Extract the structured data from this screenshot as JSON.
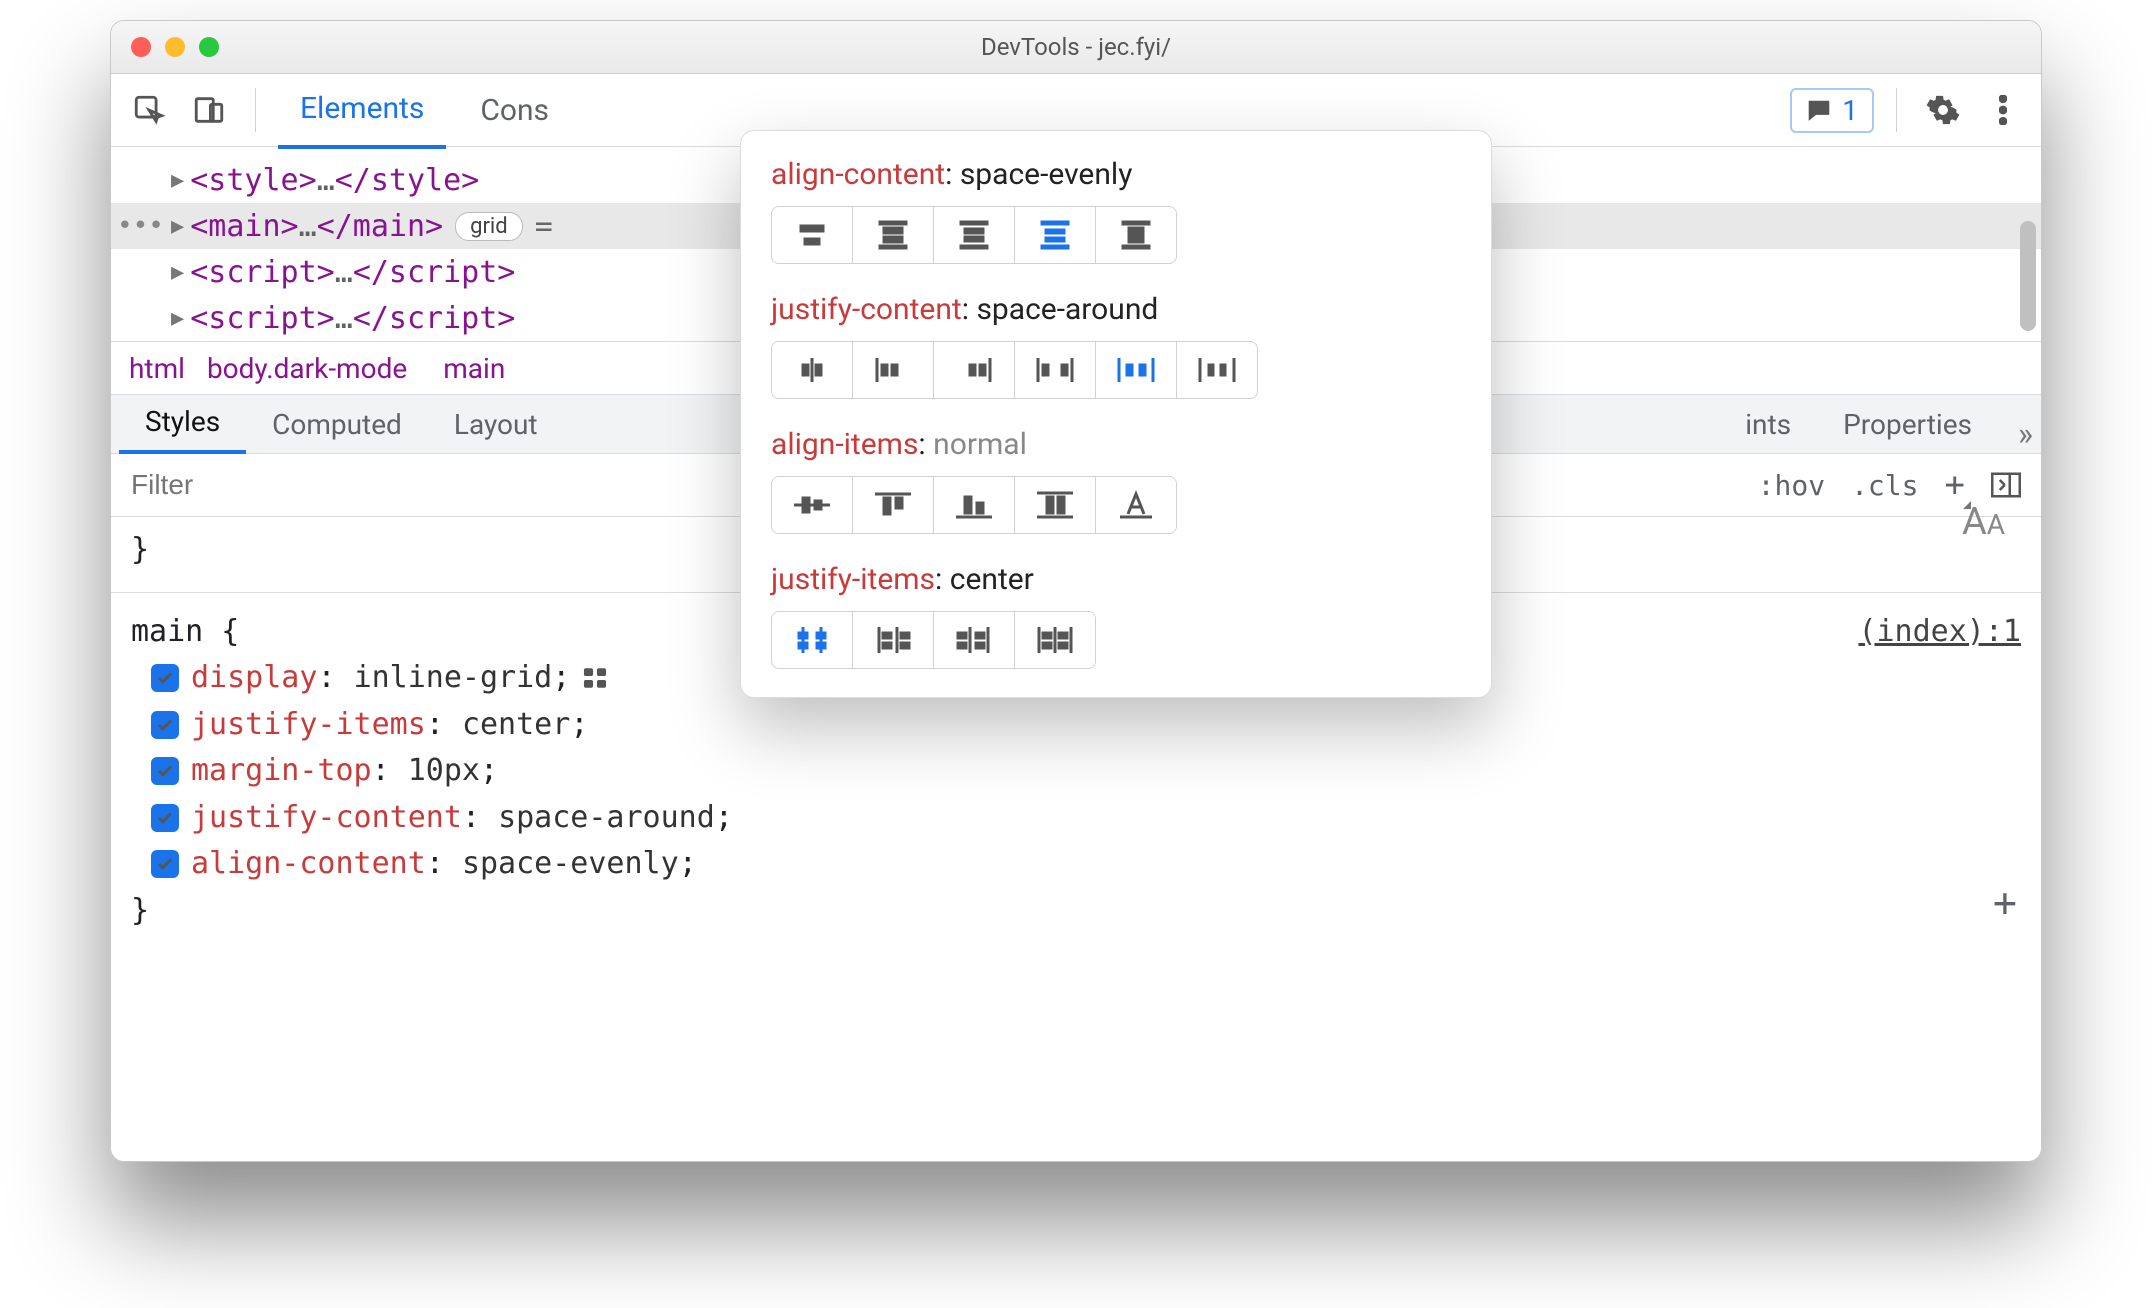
{
  "window": {
    "title": "DevTools - jec.fyi/"
  },
  "toolbar": {
    "tabs": [
      "Elements",
      "Cons"
    ],
    "active_tab": 0,
    "feedback_count": "1"
  },
  "dom": {
    "rows": [
      {
        "open": "<style>",
        "mid": "…",
        "close": "</style>",
        "selected": false
      },
      {
        "open": "<main>",
        "mid": "…",
        "close": "</main>",
        "selected": true,
        "badge": "grid",
        "eq": "="
      },
      {
        "open": "<script>",
        "mid": "…",
        "close": "</script>",
        "selected": false
      },
      {
        "open": "<script>",
        "mid": "…",
        "close": "</script>",
        "selected": false
      }
    ]
  },
  "breadcrumbs": {
    "items": [
      "html",
      "body",
      "main"
    ],
    "class_suffix": ".dark-mode"
  },
  "subtabs": {
    "items": [
      "Styles",
      "Computed",
      "Layout",
      "ints",
      "Properties"
    ],
    "active": 0
  },
  "filter": {
    "placeholder": "Filter",
    "hov": ":hov",
    "cls": ".cls"
  },
  "styles": {
    "closing_brace": "}",
    "rule_selector": "main {",
    "rule_close": "}",
    "source": "(index):1",
    "decls": [
      {
        "prop": "display",
        "colon": ":",
        "val": "inline-grid",
        "semi": ";",
        "grid_icon": true
      },
      {
        "prop": "justify-items",
        "colon": ":",
        "val": "center",
        "semi": ";"
      },
      {
        "prop": "margin-top",
        "colon": ":",
        "val": "10px",
        "semi": ";"
      },
      {
        "prop": "justify-content",
        "colon": ":",
        "val": "space-around",
        "semi": ";"
      },
      {
        "prop": "align-content",
        "colon": ":",
        "val": "space-evenly",
        "semi": ";"
      }
    ]
  },
  "popover": {
    "sections": [
      {
        "prop": "align-content",
        "val": "space-evenly",
        "muted": false,
        "buttons": 5,
        "active": 3
      },
      {
        "prop": "justify-content",
        "val": "space-around",
        "muted": false,
        "buttons": 6,
        "active": 4
      },
      {
        "prop": "align-items",
        "val": "normal",
        "muted": true,
        "buttons": 5,
        "active": -1
      },
      {
        "prop": "justify-items",
        "val": "center",
        "muted": false,
        "buttons": 4,
        "active": 0
      }
    ]
  }
}
